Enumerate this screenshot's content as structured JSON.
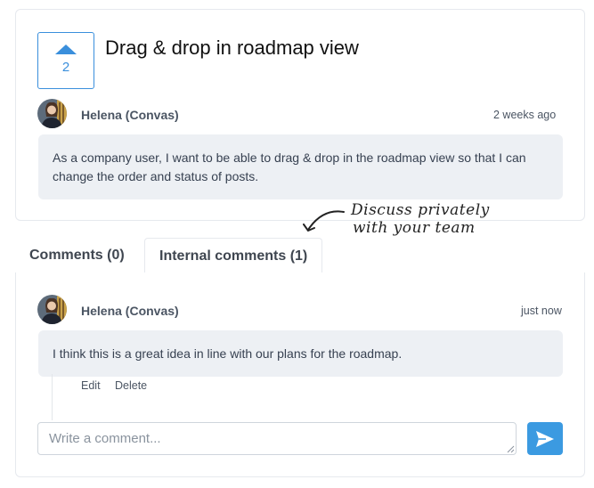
{
  "post": {
    "vote_count": "2",
    "title": "Drag & drop in roadmap view",
    "author": "Helena (Convas)",
    "timestamp": "2 weeks ago",
    "description_line1": "As a company user, I want to be able to drag & drop in the roadmap view so that I can",
    "description_line2": "change the order and status of posts."
  },
  "annotation": {
    "line1": "Discuss privately",
    "line2": "with your team"
  },
  "tabs": [
    {
      "label": "Comments (0)",
      "active": false
    },
    {
      "label": "Internal comments (1)",
      "active": true
    }
  ],
  "comment": {
    "author": "Helena (Convas)",
    "timestamp": "just now",
    "text": "I think this is a great idea in line with our plans for the roadmap.",
    "edit_label": "Edit",
    "delete_label": "Delete"
  },
  "composer": {
    "placeholder": "Write a comment...",
    "send_icon": "send-icon"
  },
  "colors": {
    "accent": "#3a8fdc",
    "send_button": "#3b9ae1",
    "bubble": "#edf0f4"
  }
}
